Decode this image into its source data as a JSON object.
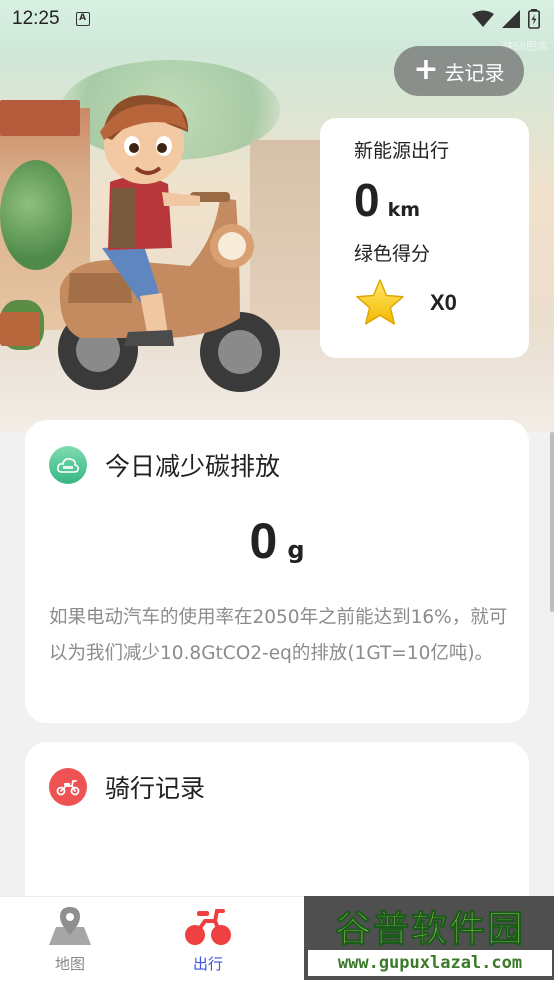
{
  "status_bar": {
    "time": "12:25",
    "notification_glyph": "A"
  },
  "hero": {
    "watermark": "快58图库"
  },
  "record_button": {
    "label": "去记录",
    "icon": "plus-icon"
  },
  "stats": {
    "new_energy_label": "新能源出行",
    "km_value": "0",
    "km_unit": "km",
    "green_score_label": "绿色得分",
    "star_icon": "star-icon",
    "multiplier": "X0"
  },
  "carbon_card": {
    "title": "今日减少碳排放",
    "icon": "co2-icon",
    "value": "0",
    "unit": "g",
    "description": "如果电动汽车的使用率在2050年之前能达到16%，就可以为我们减少10.8GtCO2-eq的排放(1GT=10亿吨)。"
  },
  "ride_card": {
    "title": "骑行记录",
    "icon": "scooter-icon"
  },
  "bottom_nav": {
    "items": [
      {
        "label": "地图",
        "icon": "map-pin-icon",
        "active": false
      },
      {
        "label": "出行",
        "icon": "bike-icon",
        "active": true
      }
    ]
  },
  "watermark": {
    "title": "谷普软件园",
    "url": "www.gupuxlazal.com"
  },
  "colors": {
    "accent": "#3b55e6",
    "co2_green": "#36b684",
    "ride_red": "#ee5252"
  }
}
